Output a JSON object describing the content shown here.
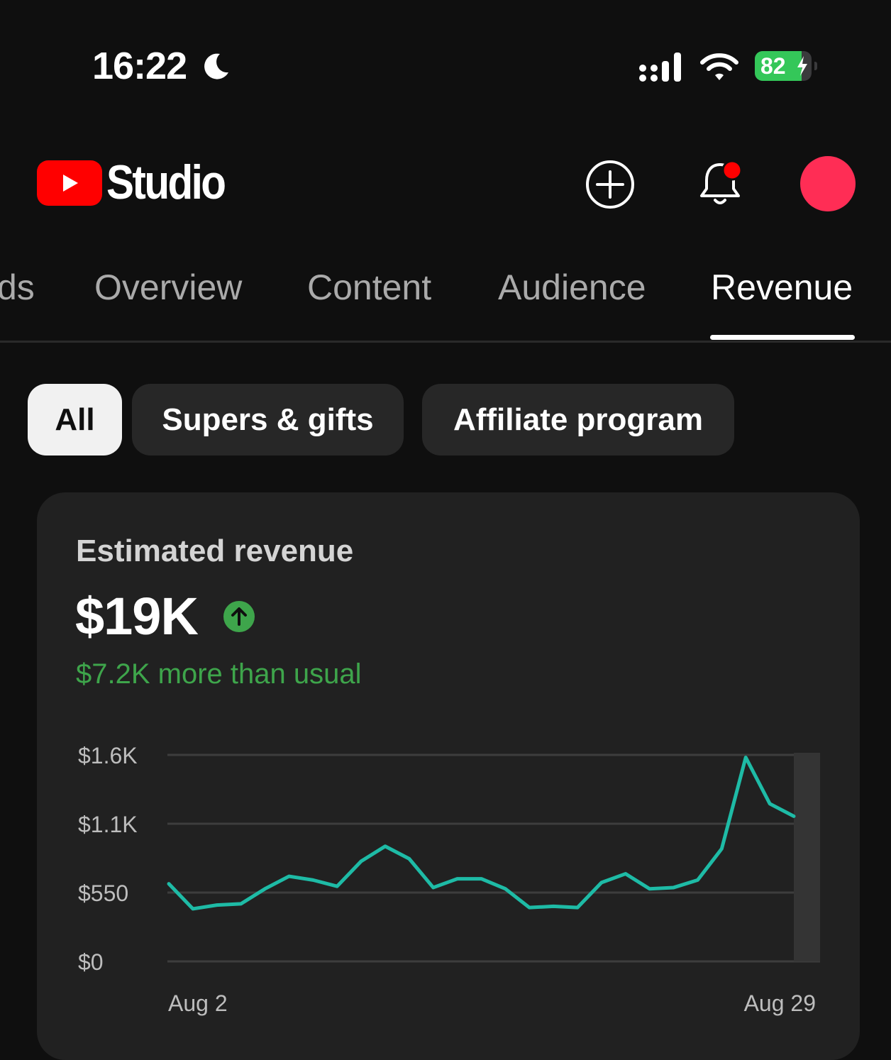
{
  "status_bar": {
    "time": "16:22",
    "battery_percent": 82,
    "battery_label": "82",
    "icons": [
      "moon-icon",
      "cellular-signal-icon",
      "wifi-icon",
      "battery-charging-icon"
    ]
  },
  "header": {
    "brand": "Studio",
    "logo": "youtube-play-logo",
    "create_icon": "plus-circle-icon",
    "notifications_icon": "bell-icon",
    "notification_badge_color": "#ff0000",
    "avatar_color": "#ff2d55"
  },
  "tabs": [
    {
      "label": "ds",
      "active": false
    },
    {
      "label": "Overview",
      "active": false
    },
    {
      "label": "Content",
      "active": false
    },
    {
      "label": "Audience",
      "active": false
    },
    {
      "label": "Revenue",
      "active": true
    }
  ],
  "chips": [
    {
      "label": "All",
      "active": true
    },
    {
      "label": "Supers & gifts",
      "active": false
    },
    {
      "label": "Affiliate program",
      "active": false
    }
  ],
  "card": {
    "title": "Estimated revenue",
    "value": "$19K",
    "trend": "up",
    "trend_color": "#3ea54b",
    "delta": "$7.2K more than usual"
  },
  "chart_data": {
    "type": "line",
    "title": "",
    "xlabel": "",
    "ylabel": "",
    "ylim": [
      0,
      1650
    ],
    "y_ticks": [
      "$1.6K",
      "$1.1K",
      "$550",
      "$0"
    ],
    "x_tick_labels": [
      "Aug 2",
      "Aug 29"
    ],
    "grid": true,
    "line_color": "#1ebba6",
    "series": [
      {
        "values": [
          620,
          420,
          450,
          460,
          580,
          680,
          650,
          600,
          800,
          920,
          820,
          590,
          660,
          660,
          580,
          430,
          440,
          430,
          630,
          700,
          580,
          590,
          650,
          900,
          1630,
          1260,
          1160
        ]
      }
    ],
    "highlighted_last_point": true
  }
}
